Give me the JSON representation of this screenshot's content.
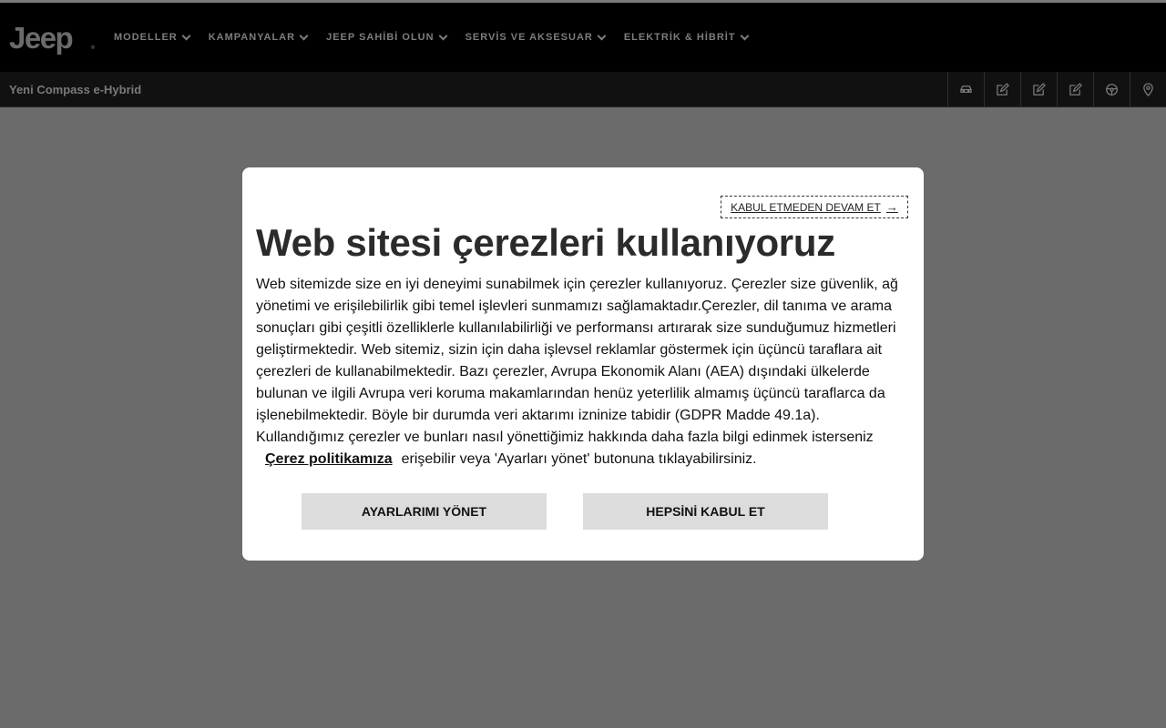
{
  "header": {
    "logo_text": "Jeep",
    "logo_mark": "®",
    "nav": [
      {
        "label": "MODELLER"
      },
      {
        "label": "KAMPANYALAR"
      },
      {
        "label": "JEEP SAHİBİ OLUN"
      },
      {
        "label": "SERVİS VE AKSESUAR"
      },
      {
        "label": "ELEKTRİK & HİBRİT"
      }
    ]
  },
  "subbar": {
    "model_name": "Yeni Compass e-Hybrid",
    "icons": [
      "car-icon",
      "edit-icon",
      "edit-icon",
      "edit-icon",
      "steering-wheel-icon",
      "location-pin-icon"
    ]
  },
  "cookie_modal": {
    "reject_label": "KABUL ETMEDEN DEVAM ET",
    "title": "Web sitesi çerezleri kullanıyoruz",
    "body": "Web sitemizde size en iyi deneyimi sunabilmek için çerezler kullanıyoruz. Çerezler size güvenlik, ağ yönetimi ve erişilebilirlik gibi temel işlevleri sunmamızı sağlamaktadır.Çerezler, dil tanıma ve arama sonuçları gibi çeşitli özelliklerle kullanılabilirliği ve performansı artırarak size sunduğumuz hizmetleri geliştirmektedir. Web sitemiz, sizin için daha işlevsel reklamlar göstermek için üçüncü taraflara ait çerezleri de kullanabilmektedir. Bazı çerezler, Avrupa Ekonomik Alanı (AEA) dışındaki ülkelerde bulunan ve ilgili Avrupa veri koruma makamlarından henüz yeterlilik almamış üçüncü taraflarca da işlenebilmektedir. Böyle bir durumda veri aktarımı izninize tabidir (GDPR Madde 49.1a). Kullandığımız çerezler ve bunları nasıl yönettiğimiz hakkında daha fazla bilgi edinmek isterseniz",
    "policy_link": "Çerez politikamıza",
    "body_end": "erişebilir veya 'Ayarları yönet' butonuna tıklayabilirsiniz.",
    "manage_button": "AYARLARIMI YÖNET",
    "accept_button": "HEPSİNİ KABUL ET"
  },
  "colors": {
    "overlay": "#6b6b6b",
    "header_bg": "#000000",
    "button_bg": "#dcdcdc"
  }
}
